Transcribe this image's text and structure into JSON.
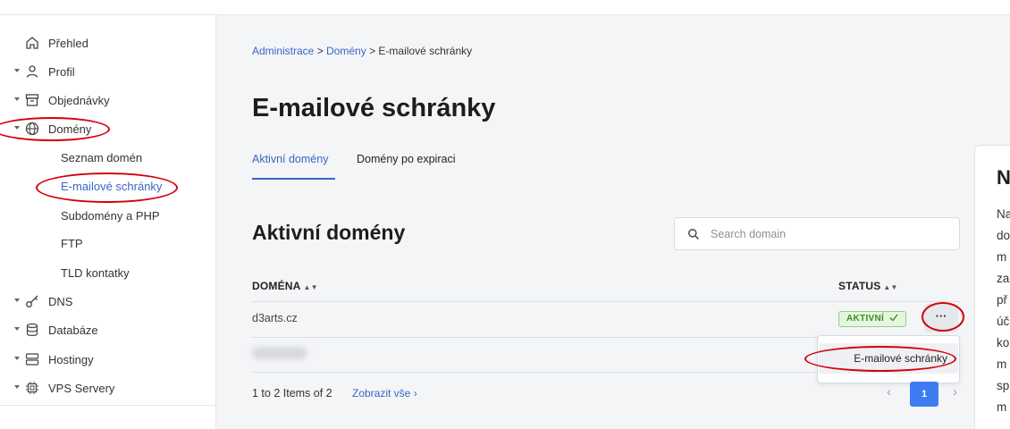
{
  "sidebar": {
    "items": [
      {
        "label": "Přehled",
        "icon": "home-icon"
      },
      {
        "label": "Profil",
        "icon": "user-icon"
      },
      {
        "label": "Objednávky",
        "icon": "archive-icon"
      },
      {
        "label": "Domény",
        "icon": "globe-icon"
      },
      {
        "label": "DNS",
        "icon": "key-icon"
      },
      {
        "label": "Databáze",
        "icon": "database-icon"
      },
      {
        "label": "Hostingy",
        "icon": "server-icon"
      },
      {
        "label": "VPS Servery",
        "icon": "chip-icon"
      }
    ],
    "subitems": [
      {
        "label": "Seznam domén"
      },
      {
        "label": "E-mailové schránky"
      },
      {
        "label": "Subdomény a PHP"
      },
      {
        "label": "FTP"
      },
      {
        "label": "TLD kontatky"
      }
    ]
  },
  "breadcrumb": {
    "part1": "Administrace",
    "sep": " > ",
    "part2": "Domény",
    "part3": "E-mailové schránky"
  },
  "page": {
    "title": "E-mailové schránky",
    "tabs": [
      {
        "label": "Aktivní domény"
      },
      {
        "label": "Domény po expiraci"
      }
    ]
  },
  "section": {
    "title": "Aktivní domény",
    "search_placeholder": "Search domain"
  },
  "table": {
    "headers": {
      "domain": "DOMÉNA",
      "status": "STATUS"
    },
    "rows": [
      {
        "domain": "d3arts.cz",
        "status": "AKTIVNÍ"
      }
    ],
    "row_menu_label": "···",
    "dropdown_item": "E-mailové schránky"
  },
  "pagination": {
    "info": "1 to 2 Items of 2",
    "show_all": "Zobrazit vše",
    "current_page": "1"
  },
  "right_panel": {
    "title": "N",
    "lines": [
      "Na",
      "do",
      "m",
      "za",
      "př",
      "úč",
      "ko",
      "m",
      "sp",
      "m"
    ]
  },
  "colors": {
    "accent": "#3a66c4",
    "button_primary": "#3f7cf2",
    "status_active_bg": "#e4f6de",
    "status_active_text": "#3b8b28",
    "annotation": "#d4000b"
  }
}
